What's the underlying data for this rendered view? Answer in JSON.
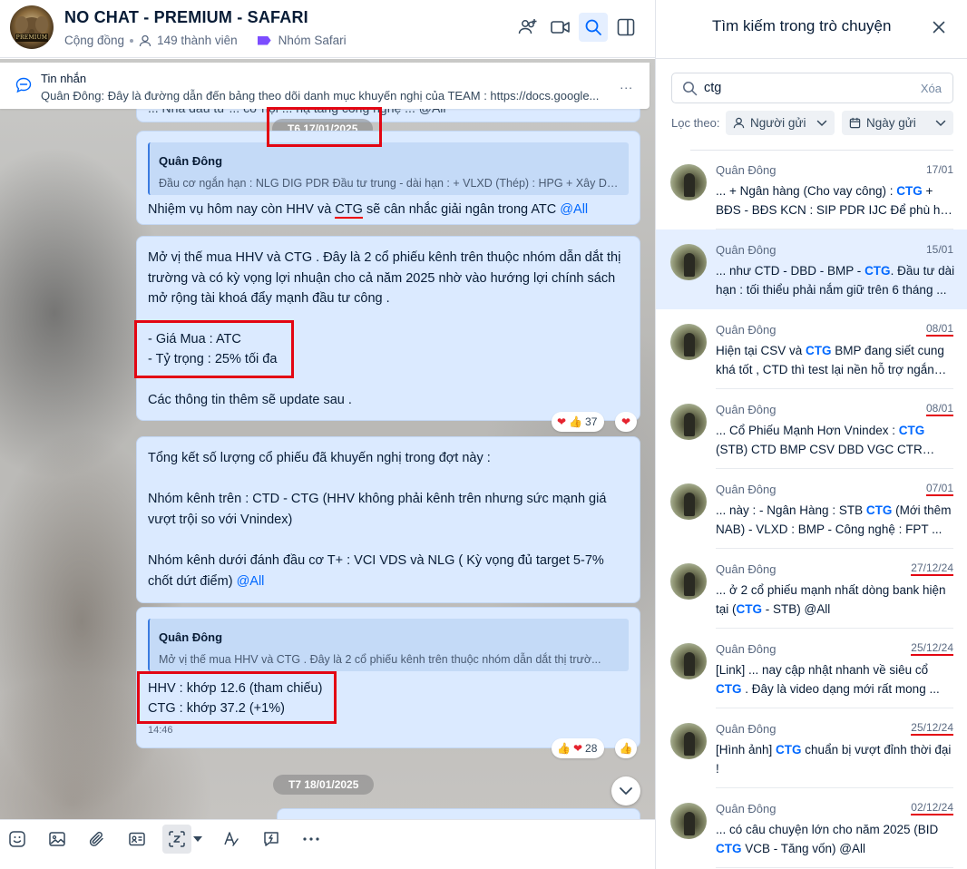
{
  "header": {
    "group_name": "NO CHAT - PREMIUM - SAFARI",
    "avatar_badge": "PREMIUM",
    "community": "Cộng đồng",
    "members": "149 thành viên",
    "tag": "Nhóm Safari",
    "icons": [
      "add-member-icon",
      "video-call-icon",
      "search-icon",
      "toggle-panel-icon"
    ]
  },
  "pinned": {
    "title": "Tin nhắn",
    "text": "Quân Đông: Đây là đường dẫn đến bảng theo dõi danh mục khuyến nghị của TEAM : https://docs.google...",
    "more": "..."
  },
  "messages": {
    "partial_top": "... Nhà đầu tư ... cơ hội ... hạ tầng công nghệ ... @All",
    "date1": "T6 17/01/2025",
    "m1": {
      "quote_name": "Quân Đông",
      "quote_text": "Đầu cơ ngắn hạn : NLG DIG PDR Đầu tư trung - dài hạn : + VLXD (Thép) : HPG + Xây Dự...",
      "text_before": "Nhiệm vụ hôm nay còn HHV và ",
      "keyword": "CTG",
      "text_after": " sẽ cân nhắc giải ngân trong ATC ",
      "mention": "@All"
    },
    "m2": {
      "p1": "Mở vị thế mua HHV và CTG . Đây là 2 cổ phiếu kênh trên thuộc nhóm dẫn dắt thị trường và có kỳ vọng lợi nhuận cho cả năm 2025 nhờ vào hướng lợi chính sách mở rộng tài khoá đẩy mạnh đầu tư công .",
      "l1": "- Giá Mua : ATC",
      "l2": "- Tỷ trọng : 25% tối đa",
      "p3": "Các thông tin thêm sẽ update sau .",
      "reaction_count": "37"
    },
    "m3": {
      "p1": "Tổng kết số lượng cổ phiếu đã khuyến nghị trong đợt này :",
      "p2": "Nhóm kênh trên : CTD - CTG (HHV không phải kênh trên nhưng sức mạnh giá vượt trội so với Vnindex)",
      "p3": "Nhóm kênh dưới đánh đầu cơ T+ : VCI VDS và NLG ( Kỳ vọng đủ target 5-7% chốt dứt điểm) ",
      "mention": "@All"
    },
    "m4": {
      "quote_name": "Quân Đông",
      "quote_text": "Mở vị thế mua HHV và CTG . Đây là 2 cổ phiếu kênh trên thuộc nhóm dẫn dắt thị trườ...",
      "l1": "HHV : khớp 12.6 (tham chiếu)",
      "l2": "CTG : khớp 37.2 (+1%)",
      "time": "14:46",
      "reaction_count": "28"
    },
    "date2": "T7 18/01/2025"
  },
  "toolbar": {
    "icons": [
      "sticker-icon",
      "image-icon",
      "attachment-icon",
      "contact-card-icon",
      "screenshot-icon",
      "dropdown-icon",
      "format-text-icon",
      "quick-message-icon",
      "more-icon"
    ]
  },
  "search": {
    "title": "Tìm kiếm trong trò chuyện",
    "query": "ctg",
    "clear_label": "Xóa",
    "filter_label": "Lọc theo:",
    "filter_sender": "Người gửi",
    "filter_date": "Ngày gửi",
    "results": [
      {
        "name": "Quân Đông",
        "date": "17/01",
        "pre": "... + Ngân hàng (Cho vay công) : ",
        "kw": "CTG",
        "post": " + BĐS - BĐS KCN : SIP PDR IJC Để phù hợp với ..."
      },
      {
        "name": "Quân Đông",
        "date": "15/01",
        "pre": "... như CTD - DBD - BMP - ",
        "kw": "CTG",
        "post": ". Đầu tư dài hạn : tối thiểu phải nắm giữ trên 6 tháng ..."
      },
      {
        "name": "Quân Đông",
        "date": "08/01",
        "pre": "Hiện tại CSV và ",
        "kw": "CTG",
        "post": " BMP đang siết cung khá tốt , CTD thì test lại nền hỗ trợ ngắn hạn ..."
      },
      {
        "name": "Quân Đông",
        "date": "08/01",
        "pre": "... Cổ Phiếu Mạnh Hơn Vnindex : ",
        "kw": "CTG",
        "post": " (STB) CTD BMP CSV DBD VGC CTR (BCG) ..."
      },
      {
        "name": "Quân Đông",
        "date": "07/01",
        "pre": "... này : - Ngân Hàng : STB ",
        "kw": "CTG",
        "post": " (Mới thêm NAB) - VLXD : BMP - Công nghệ : FPT ..."
      },
      {
        "name": "Quân Đông",
        "date": "27/12/24",
        "pre": "... ở 2 cổ phiếu mạnh nhất dòng bank hiện tại (",
        "kw": "CTG",
        "post": " - STB) @All"
      },
      {
        "name": "Quân Đông",
        "date": "25/12/24",
        "pre": "[Link] ... nay cập nhật nhanh về siêu cổ ",
        "kw": "CTG",
        "post": " . Đây là video dạng mới rất mong ..."
      },
      {
        "name": "Quân Đông",
        "date": "25/12/24",
        "pre": "[Hình ảnh] ",
        "kw": "CTG",
        "post": " chuẩn bị vượt đỉnh thời đại !"
      },
      {
        "name": "Quân Đông",
        "date": "02/12/24",
        "pre": "... có câu chuyện lớn cho năm 2025 (BID ",
        "kw": "CTG",
        "post": " VCB - Tăng vốn) @All"
      }
    ]
  },
  "colors": {
    "accent": "#0068ff",
    "highlight_box": "#e30613",
    "bubble": "#dbeaff"
  }
}
